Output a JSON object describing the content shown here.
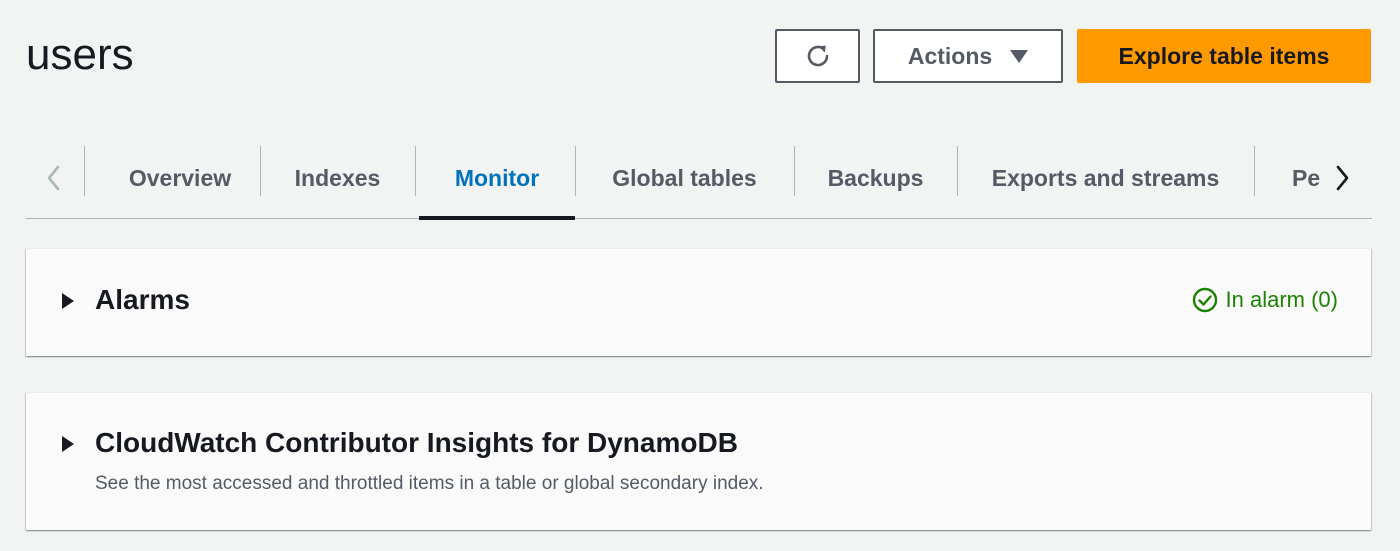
{
  "header": {
    "title": "users",
    "refresh_icon": "refresh-icon",
    "actions_label": "Actions",
    "actions_icon": "caret-down-icon",
    "explore_label": "Explore table items"
  },
  "tabs": {
    "items": [
      {
        "label": "Overview",
        "active": false
      },
      {
        "label": "Indexes",
        "active": false
      },
      {
        "label": "Monitor",
        "active": true
      },
      {
        "label": "Global tables",
        "active": false
      },
      {
        "label": "Backups",
        "active": false
      },
      {
        "label": "Exports and streams",
        "active": false
      },
      {
        "label": "Pe",
        "active": false
      }
    ],
    "scroll_left_icon": "chevron-left-icon",
    "scroll_right_icon": "chevron-right-icon"
  },
  "panels": {
    "alarms": {
      "title": "Alarms",
      "status_text": "In alarm (0)",
      "status_icon": "check-circle-icon",
      "status_color": "#1d8102"
    },
    "insights": {
      "title": "CloudWatch Contributor Insights for DynamoDB",
      "description": "See the most accessed and throttled items in a table or global secondary index."
    }
  },
  "colors": {
    "accent": "#ff9900",
    "active_tab": "#0073bb",
    "background": "#f2f3f3"
  }
}
